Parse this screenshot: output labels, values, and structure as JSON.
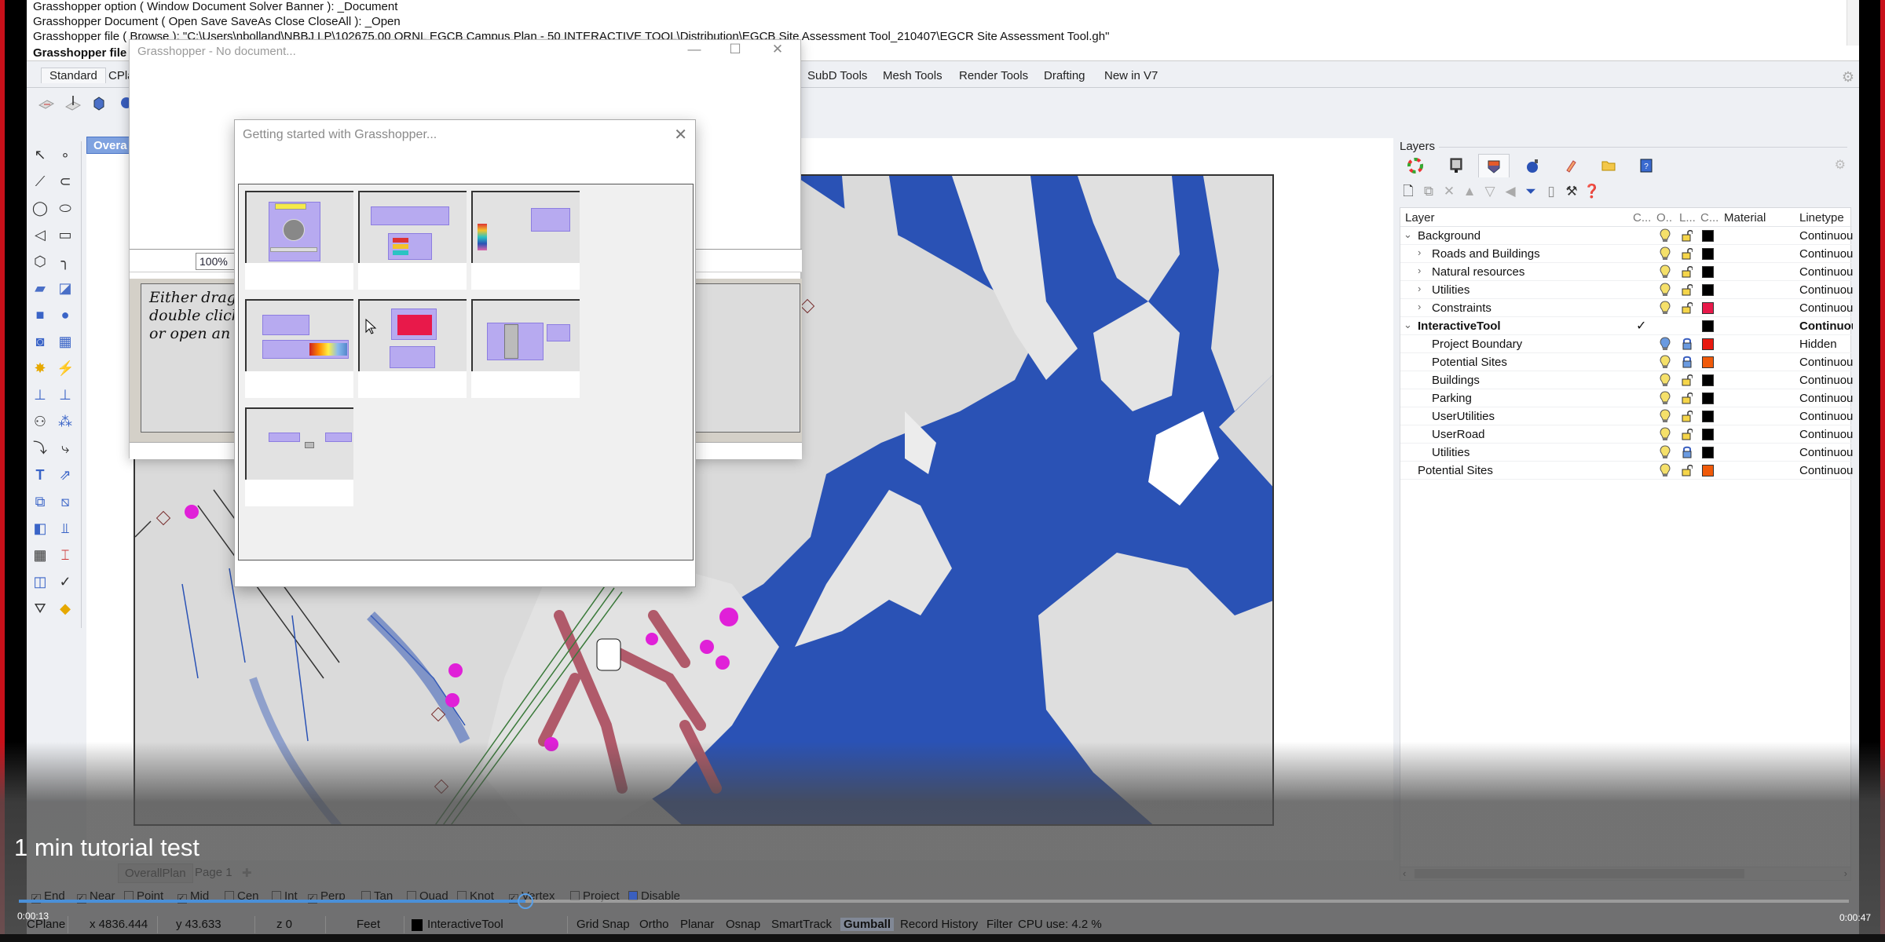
{
  "command_history": [
    "Grasshopper option ( Window  Document  Solver  Banner ): _Document",
    "Grasshopper Document ( Open  Save  SaveAs  Close  CloseAll ): _Open",
    "Grasshopper file ( Browse ): \"C:\\Users\\nbolland\\NBBJ LP\\102675.00 ORNL EGCB Campus Plan - 50 INTERACTIVE TOOL\\Distribution\\EGCB Site Assessment Tool_210407\\EGCR Site Assessment Tool.gh\""
  ],
  "command_prompt": "Grasshopper file (",
  "toolbar_tabs": [
    "Standard",
    "CPla",
    "SubD Tools",
    "Mesh Tools",
    "Render Tools",
    "Drafting",
    "New in V7"
  ],
  "viewport_tab": "Overa",
  "grasshopper_window": {
    "title": "Grasshopper - No document...",
    "zoom": "100%",
    "hint_lines": [
      "Either drag a",
      "double click th",
      "or open an ex"
    ]
  },
  "getting_started": {
    "title": "Getting started with Grasshopper...",
    "thumbnail_count": 7
  },
  "layers_panel": {
    "title": "Layers",
    "tabs": [
      "color-wheel-icon",
      "display-icon",
      "layers-icon",
      "render-bomb-icon",
      "paint-icon",
      "folder-icon",
      "help-doc-icon"
    ],
    "columns": {
      "layer": "Layer",
      "current": "C...",
      "on": "O..",
      "lock": "L...",
      "color": "C...",
      "material": "Material",
      "linetype": "Linetype"
    },
    "rows": [
      {
        "name": "Background",
        "level": 0,
        "expand": "open",
        "on": true,
        "locked": false,
        "color": "#000000",
        "linetype": "Continuous",
        "bold": false,
        "current": false
      },
      {
        "name": "Roads and Buildings",
        "level": 1,
        "expand": "closed",
        "on": true,
        "locked": false,
        "color": "#000000",
        "linetype": "Continuous",
        "bold": false,
        "current": false
      },
      {
        "name": "Natural resources",
        "level": 1,
        "expand": "closed",
        "on": true,
        "locked": false,
        "color": "#000000",
        "linetype": "Continuous",
        "bold": false,
        "current": false
      },
      {
        "name": "Utilities",
        "level": 1,
        "expand": "closed",
        "on": true,
        "locked": false,
        "color": "#000000",
        "linetype": "Continuous",
        "bold": false,
        "current": false
      },
      {
        "name": "Constraints",
        "level": 1,
        "expand": "closed",
        "on": true,
        "locked": false,
        "color": "#e8194a",
        "linetype": "Continuous",
        "bold": false,
        "current": false
      },
      {
        "name": "InteractiveTool",
        "level": 0,
        "expand": "open",
        "on": null,
        "locked": null,
        "color": "#000000",
        "linetype": "Continuous",
        "bold": true,
        "current": true
      },
      {
        "name": "Project Boundary",
        "level": 1,
        "expand": "",
        "on": false,
        "locked": true,
        "color": "#e8190f",
        "linetype": "Hidden",
        "bold": false,
        "current": false
      },
      {
        "name": "Potential Sites",
        "level": 1,
        "expand": "",
        "on": true,
        "locked": true,
        "color": "#f05a0a",
        "linetype": "Continuous",
        "bold": false,
        "current": false
      },
      {
        "name": "Buildings",
        "level": 1,
        "expand": "",
        "on": true,
        "locked": false,
        "color": "#000000",
        "linetype": "Continuous",
        "bold": false,
        "current": false
      },
      {
        "name": "Parking",
        "level": 1,
        "expand": "",
        "on": true,
        "locked": false,
        "color": "#000000",
        "linetype": "Continuous",
        "bold": false,
        "current": false
      },
      {
        "name": "UserUtilities",
        "level": 1,
        "expand": "",
        "on": true,
        "locked": false,
        "color": "#000000",
        "linetype": "Continuous",
        "bold": false,
        "current": false
      },
      {
        "name": "UserRoad",
        "level": 1,
        "expand": "",
        "on": true,
        "locked": false,
        "color": "#000000",
        "linetype": "Continuous",
        "bold": false,
        "current": false
      },
      {
        "name": "Utilities",
        "level": 1,
        "expand": "",
        "on": true,
        "locked": true,
        "color": "#000000",
        "linetype": "Continuous",
        "bold": false,
        "current": false
      },
      {
        "name": "Potential Sites",
        "level": 0,
        "expand": "",
        "on": true,
        "locked": false,
        "color": "#f05a0a",
        "linetype": "Continuous",
        "bold": false,
        "current": false
      }
    ]
  },
  "video": {
    "title": "1 min tutorial test",
    "current_time": "0:00:13",
    "end_time": "0:00:47",
    "progress_fraction": 0.277
  },
  "page_tabs": [
    "OverallPlan",
    "Page 1"
  ],
  "osnaps": [
    {
      "label": "End",
      "checked": true
    },
    {
      "label": "Near",
      "checked": true
    },
    {
      "label": "Point",
      "checked": false
    },
    {
      "label": "Mid",
      "checked": true
    },
    {
      "label": "Cen",
      "checked": false
    },
    {
      "label": "Int",
      "checked": false
    },
    {
      "label": "Perp",
      "checked": true
    },
    {
      "label": "Tan",
      "checked": false
    },
    {
      "label": "Quad",
      "checked": false
    },
    {
      "label": "Knot",
      "checked": false
    },
    {
      "label": "Vertex",
      "checked": true
    },
    {
      "label": "Project",
      "checked": false
    },
    {
      "label": "Disable",
      "checked": false
    }
  ],
  "status_bar": {
    "cplane": "CPlane",
    "x": "x 4836.444",
    "y": "y 43.633",
    "z": "z 0",
    "units": "Feet",
    "layer": "InteractiveTool",
    "grid_snap": "Grid Snap",
    "ortho": "Ortho",
    "planar": "Planar",
    "osnap": "Osnap",
    "smarttrack": "SmartTrack",
    "gumball": "Gumball",
    "record_history": "Record History",
    "filter": "Filter",
    "cpu": "CPU use: 4.2 %"
  },
  "colors": {
    "water": "#2950b4",
    "land": "#d9d9d9",
    "site_marker": "#e020d8",
    "road_buffer": "#b05a6a"
  }
}
